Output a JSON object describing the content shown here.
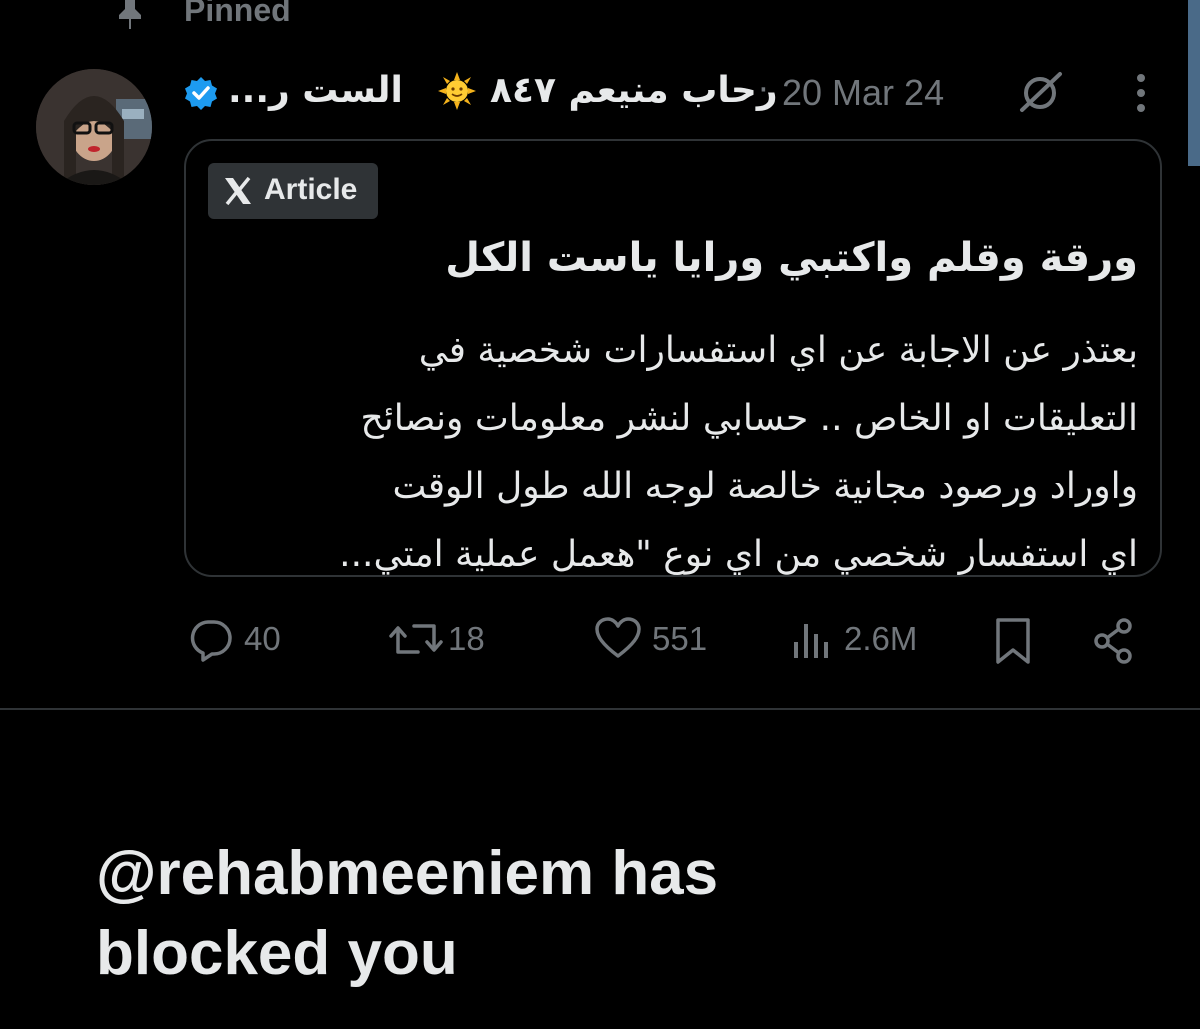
{
  "pinned": {
    "label": "Pinned"
  },
  "post": {
    "author": {
      "display_name_prefix": "الست ر...",
      "display_name_suffix": "رحاب منيعم ٨٤٧",
      "sun_emoji": "🌞",
      "verified": true
    },
    "separator": "·",
    "date": "20 Mar 24",
    "article": {
      "badge_label": "Article",
      "title": "ورقة وقلم واكتبي ورايا ياست الكل",
      "body_lines": [
        "بعتذر عن الاجابة عن اي استفسارات  شخصية في",
        "التعليقات او الخاص  .. حسابي لنشر معلومات ونصائح",
        "واوراد ورصود  مجانية خالصة لوجه الله طول الوقت",
        "اي استفسار شخصي  من اي نوع \"هعمل عملية امتي..."
      ]
    },
    "actions": {
      "replies": "40",
      "reposts": "18",
      "likes": "551",
      "views": "2.6M"
    }
  },
  "blocked_notice": {
    "line1": "@rehabmeeniem has",
    "line2": "blocked you"
  },
  "colors": {
    "background": "#000000",
    "text_primary": "#e7e9ea",
    "text_secondary": "#71767b",
    "border": "#2f3336",
    "verified_blue": "#1d9bf0"
  }
}
